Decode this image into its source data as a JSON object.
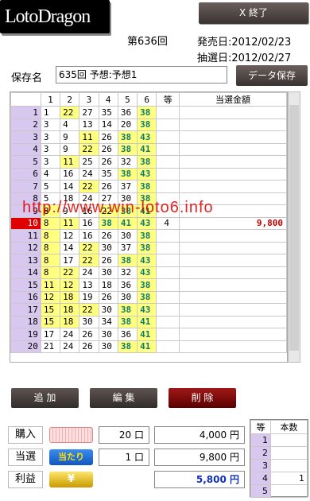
{
  "app": {
    "title": "LotoDragon",
    "exit_label": "X 終了"
  },
  "header": {
    "draw_number": "第636回",
    "release_date": "発売日:2012/02/23",
    "lottery_date": "抽選日:2012/02/27"
  },
  "save": {
    "label": "保存名",
    "name_value": "635回 予想:予想1",
    "button_label": "データ保存"
  },
  "grid": {
    "headers": [
      "",
      "1",
      "2",
      "3",
      "4",
      "5",
      "6",
      "等",
      "当選金額"
    ],
    "rows": [
      {
        "no": "1",
        "nums": [
          "1",
          "22",
          "27",
          "35",
          "36",
          "38"
        ],
        "rank": "",
        "amount": ""
      },
      {
        "no": "2",
        "nums": [
          "3",
          "4",
          "13",
          "14",
          "20",
          "38"
        ],
        "rank": "",
        "amount": ""
      },
      {
        "no": "3",
        "nums": [
          "3",
          "9",
          "11",
          "26",
          "38",
          "43"
        ],
        "rank": "",
        "amount": ""
      },
      {
        "no": "4",
        "nums": [
          "3",
          "9",
          "22",
          "26",
          "38",
          "41"
        ],
        "rank": "",
        "amount": ""
      },
      {
        "no": "5",
        "nums": [
          "3",
          "11",
          "25",
          "26",
          "32",
          "38"
        ],
        "rank": "",
        "amount": ""
      },
      {
        "no": "6",
        "nums": [
          "4",
          "16",
          "24",
          "35",
          "38",
          "43"
        ],
        "rank": "",
        "amount": ""
      },
      {
        "no": "7",
        "nums": [
          "5",
          "14",
          "22",
          "26",
          "37",
          "38"
        ],
        "rank": "",
        "amount": ""
      },
      {
        "no": "8",
        "nums": [
          "5",
          "18",
          "24",
          "27",
          "30",
          "38"
        ],
        "rank": "",
        "amount": ""
      },
      {
        "no": "9",
        "nums": [
          "8",
          "9",
          "16",
          "22",
          "38",
          "41"
        ],
        "rank": "",
        "amount": ""
      },
      {
        "no": "10",
        "nums": [
          "8",
          "11",
          "16",
          "38",
          "41",
          "43"
        ],
        "rank": "4",
        "amount": "9,800"
      },
      {
        "no": "11",
        "nums": [
          "8",
          "12",
          "16",
          "26",
          "30",
          "38"
        ],
        "rank": "",
        "amount": ""
      },
      {
        "no": "12",
        "nums": [
          "8",
          "14",
          "22",
          "30",
          "37",
          "38"
        ],
        "rank": "",
        "amount": ""
      },
      {
        "no": "13",
        "nums": [
          "8",
          "17",
          "22",
          "26",
          "38",
          "43"
        ],
        "rank": "",
        "amount": ""
      },
      {
        "no": "14",
        "nums": [
          "8",
          "22",
          "24",
          "30",
          "32",
          "43"
        ],
        "rank": "",
        "amount": ""
      },
      {
        "no": "15",
        "nums": [
          "11",
          "12",
          "13",
          "18",
          "36",
          "38"
        ],
        "rank": "",
        "amount": ""
      },
      {
        "no": "16",
        "nums": [
          "12",
          "18",
          "19",
          "26",
          "30",
          "38"
        ],
        "rank": "",
        "amount": ""
      },
      {
        "no": "17",
        "nums": [
          "15",
          "18",
          "22",
          "30",
          "38",
          "43"
        ],
        "rank": "",
        "amount": ""
      },
      {
        "no": "18",
        "nums": [
          "15",
          "18",
          "30",
          "34",
          "38",
          "41"
        ],
        "rank": "",
        "amount": ""
      },
      {
        "no": "19",
        "nums": [
          "17",
          "24",
          "26",
          "30",
          "36",
          "41"
        ],
        "rank": "",
        "amount": ""
      },
      {
        "no": "20",
        "nums": [
          "21",
          "24",
          "26",
          "30",
          "38",
          "41"
        ],
        "rank": "",
        "amount": ""
      }
    ]
  },
  "watermark": "http://www.win-loto6.info",
  "actions": {
    "add": "追 加",
    "edit": "編 集",
    "delete": "削 除"
  },
  "summary": {
    "purchase": {
      "label": "購入",
      "count": "20 口",
      "amount": "4,000 円"
    },
    "won": {
      "label": "当選",
      "icon_text": "当たり",
      "count": "1 口",
      "amount": "9,800 円"
    },
    "profit": {
      "label": "利益",
      "icon_text": "¥",
      "amount": "5,800 円"
    }
  },
  "ranks": {
    "headers": [
      "等",
      "本数"
    ],
    "rows": [
      {
        "rank": "1",
        "count": ""
      },
      {
        "rank": "2",
        "count": ""
      },
      {
        "rank": "3",
        "count": ""
      },
      {
        "rank": "4",
        "count": "1"
      },
      {
        "rank": "5",
        "count": ""
      }
    ]
  },
  "colors": {
    "hit": "#ffff80",
    "rowNum": "#d8c8f0",
    "winRow": "#e00000",
    "bonus": "#0e7a6e",
    "amount": "#c00000",
    "profit": "#1030c0"
  },
  "highlights": {
    "hit_numbers": [
      "8",
      "11",
      "22",
      "36",
      "38",
      "41",
      "43",
      "12",
      "18",
      "15",
      "16",
      "30"
    ]
  }
}
